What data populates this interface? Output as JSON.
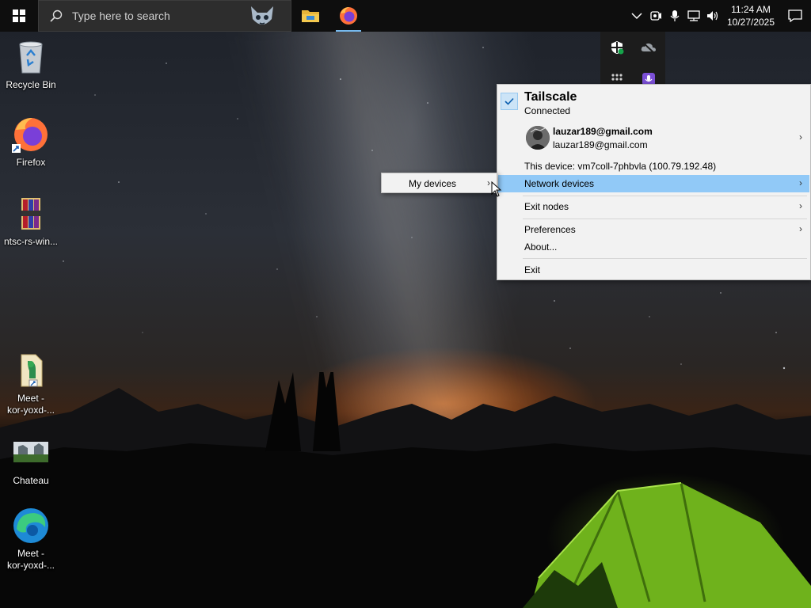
{
  "taskbar": {
    "search_placeholder": "Type here to search",
    "apps": [
      {
        "name": "file-explorer",
        "icon": "folder-icon"
      },
      {
        "name": "firefox",
        "icon": "firefox-icon",
        "active": true
      }
    ],
    "clock": {
      "time": "11:24 AM",
      "date": "10/27/2025"
    }
  },
  "desktop": {
    "icons": [
      {
        "label": "Recycle Bin",
        "icon": "recycle-bin-icon"
      },
      {
        "label": "Firefox",
        "icon": "firefox-icon"
      },
      {
        "label": "ntsc-rs-win...",
        "icon": "winrar-archive-icon"
      },
      {
        "label": "Meet - kor-yoxd-...",
        "line1": "Meet -",
        "line2": "kor-yoxd-...",
        "icon": "shortcut-file-icon"
      },
      {
        "label": "Chateau",
        "icon": "image-thumbnail-icon"
      },
      {
        "label": "Meet - kor-yoxd-...",
        "line1": "Meet -",
        "line2": "kor-yoxd-...",
        "icon": "edge-icon"
      }
    ]
  },
  "tray_overflow": {
    "icons": [
      "security-shield-icon",
      "onedrive-offline-icon",
      "tailscale-icon",
      "microphone-app-icon"
    ]
  },
  "tailscale_menu": {
    "title": "Tailscale",
    "status": "Connected",
    "account": {
      "name": "lauzar189@gmail.com",
      "email": "lauzar189@gmail.com"
    },
    "this_device": "This device: vm7coll-7phbvla (100.79.192.48)",
    "items": {
      "network_devices": "Network devices",
      "exit_nodes": "Exit nodes",
      "preferences": "Preferences",
      "about": "About...",
      "exit": "Exit"
    },
    "submenu": {
      "my_devices": "My devices"
    }
  },
  "colors": {
    "taskbar_bg": "#0e0e0e",
    "search_bg": "#2d2d2d",
    "menu_bg": "#f2f2f2",
    "highlight": "#91c9f7",
    "accent": "#0078d7"
  }
}
